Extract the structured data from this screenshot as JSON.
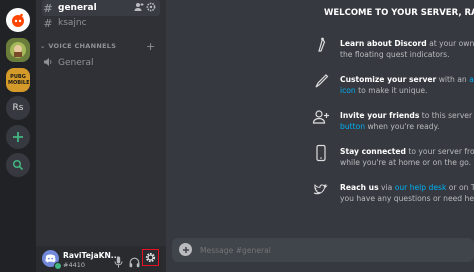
{
  "servers": {
    "rs_label": "Rs",
    "pubg_label": "PUBG MOBILE"
  },
  "channels": {
    "general": "general",
    "ksajnc": "ksajnc",
    "voice_category": "VOICE CHANNELS",
    "voice_general": "General"
  },
  "user": {
    "name": "RaviTejaKN...",
    "tag": "#4410"
  },
  "welcome": {
    "title": "WELCOME TO YOUR SERVER, RAVI",
    "items": [
      {
        "bold": "Learn about Discord",
        "rest": " at your own pa",
        "line2": "the floating quest indicators."
      },
      {
        "bold": "Customize your server",
        "rest": " with an ",
        "link": "aweso",
        "line2_link": "icon",
        "line2": " to make it unique."
      },
      {
        "bold": "Invite your friends",
        "rest": " to this server by cli",
        "line2_link": "button",
        "line2": " when you're ready."
      },
      {
        "bold": "Stay connected",
        "rest": " to your server from ",
        "link": "yo",
        "line2": "while you're at home or on the go."
      },
      {
        "bold": "Reach us",
        "rest": " via ",
        "link": "our help desk",
        "rest2": " or on Twitt",
        "line2": "you have any questions or need help."
      }
    ]
  },
  "composer": {
    "placeholder": "Message #general"
  },
  "colors": {
    "accent": "#7289da",
    "green": "#43b581",
    "link": "#00b0f4",
    "highlight": "#e81123"
  }
}
